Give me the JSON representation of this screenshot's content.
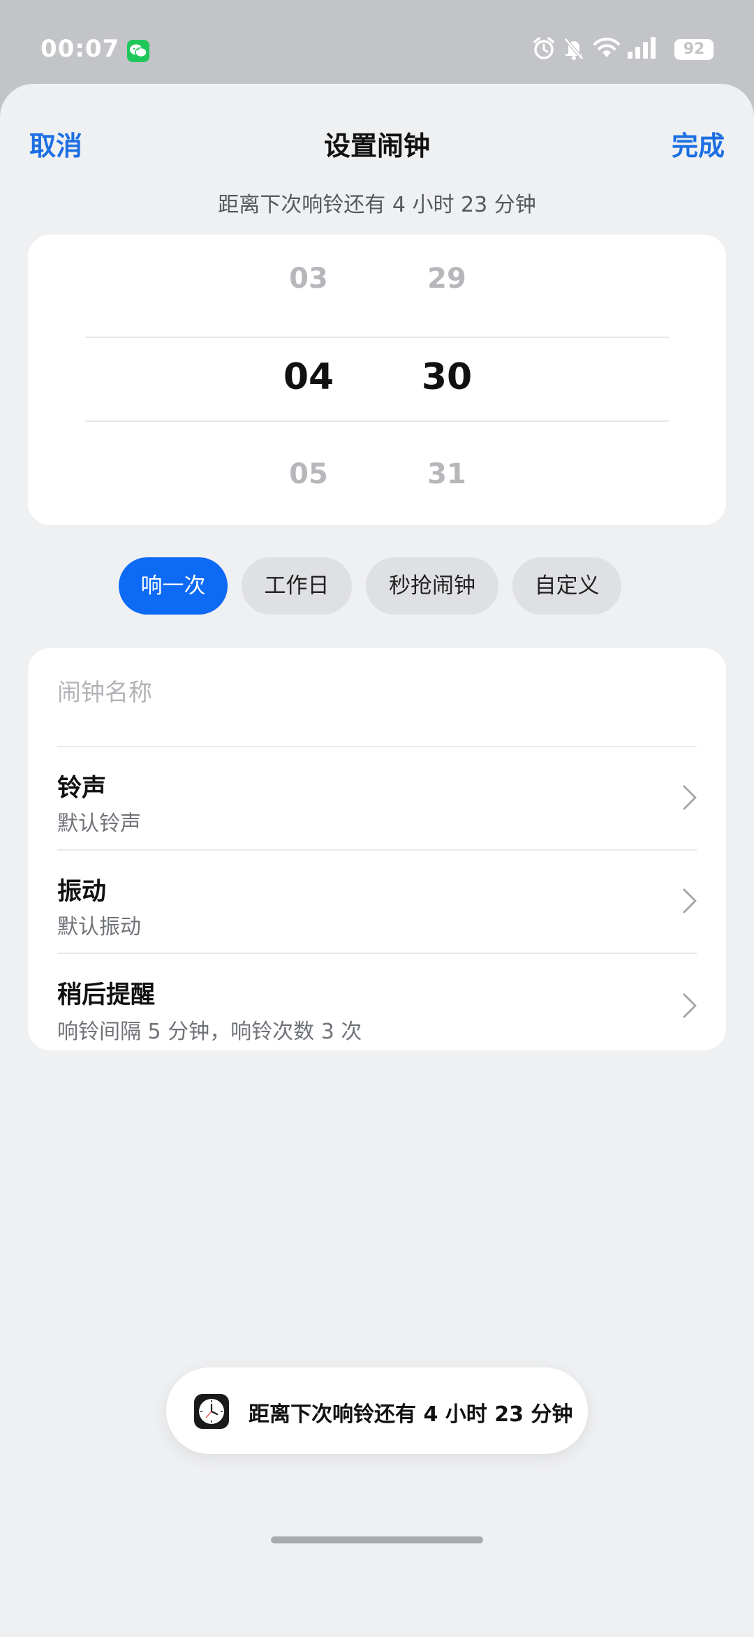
{
  "status_bar": {
    "time": "00:07",
    "battery": "92",
    "icons": [
      "wechat-icon",
      "alarm-icon",
      "mute-bell-icon",
      "wifi-icon",
      "signal-icon",
      "battery-icon"
    ]
  },
  "header": {
    "cancel_label": "取消",
    "title": "设置闹钟",
    "done_label": "完成",
    "subtitle": "距离下次响铃还有 4 小时 23 分钟"
  },
  "picker": {
    "hours": {
      "prev": "03",
      "selected": "04",
      "next": "05"
    },
    "minutes": {
      "prev": "29",
      "selected": "30",
      "next": "31"
    }
  },
  "repeat_options": [
    {
      "label": "响一次",
      "active": true
    },
    {
      "label": "工作日",
      "active": false
    },
    {
      "label": "秒抢闹钟",
      "active": false
    },
    {
      "label": "自定义",
      "active": false
    }
  ],
  "settings": {
    "name_placeholder": "闹钟名称",
    "rows": [
      {
        "title": "铃声",
        "value": "默认铃声"
      },
      {
        "title": "振动",
        "value": "默认振动"
      },
      {
        "title": "稍后提醒",
        "value": "响铃间隔 5 分钟，响铃次数 3 次"
      }
    ]
  },
  "toast": {
    "text": "距离下次响铃还有 4 小时 23 分钟",
    "icon": "clock-app-icon"
  },
  "colors": {
    "accent": "#1c6fe3",
    "chip_active": "#0d6af5",
    "background": "#eff0f2"
  }
}
